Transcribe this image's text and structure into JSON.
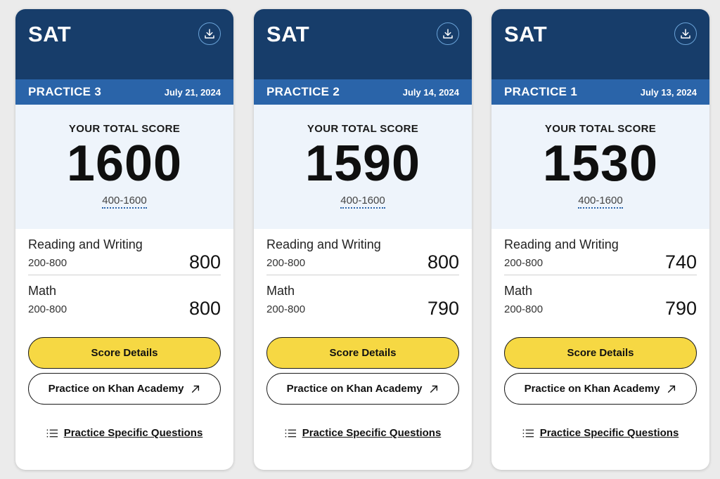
{
  "colors": {
    "header_bg": "#173d6a",
    "practice_bar_bg": "#2a64a9",
    "score_area_bg": "#eef4fb",
    "primary_button": "#f6d843",
    "page_bg": "#ebebeb"
  },
  "icons": {
    "download": "download-icon",
    "external_link": "arrow-up-right-icon",
    "list": "list-icon"
  },
  "cards": [
    {
      "exam": "SAT",
      "practice": "PRACTICE 3",
      "date": "July 21, 2024",
      "total_label": "YOUR TOTAL SCORE",
      "total_score": "1600",
      "total_range": "400-1600",
      "sections": [
        {
          "name": "Reading and Writing",
          "range": "200-800",
          "score": "800"
        },
        {
          "name": "Math",
          "range": "200-800",
          "score": "800"
        }
      ],
      "score_details_label": "Score Details",
      "khan_label": "Practice on Khan Academy",
      "questions_label": "Practice Specific Questions"
    },
    {
      "exam": "SAT",
      "practice": "PRACTICE 2",
      "date": "July 14, 2024",
      "total_label": "YOUR TOTAL SCORE",
      "total_score": "1590",
      "total_range": "400-1600",
      "sections": [
        {
          "name": "Reading and Writing",
          "range": "200-800",
          "score": "800"
        },
        {
          "name": "Math",
          "range": "200-800",
          "score": "790"
        }
      ],
      "score_details_label": "Score Details",
      "khan_label": "Practice on Khan Academy",
      "questions_label": "Practice Specific Questions"
    },
    {
      "exam": "SAT",
      "practice": "PRACTICE 1",
      "date": "July 13, 2024",
      "total_label": "YOUR TOTAL SCORE",
      "total_score": "1530",
      "total_range": "400-1600",
      "sections": [
        {
          "name": "Reading and Writing",
          "range": "200-800",
          "score": "740"
        },
        {
          "name": "Math",
          "range": "200-800",
          "score": "790"
        }
      ],
      "score_details_label": "Score Details",
      "khan_label": "Practice on Khan Academy",
      "questions_label": "Practice Specific Questions"
    }
  ]
}
